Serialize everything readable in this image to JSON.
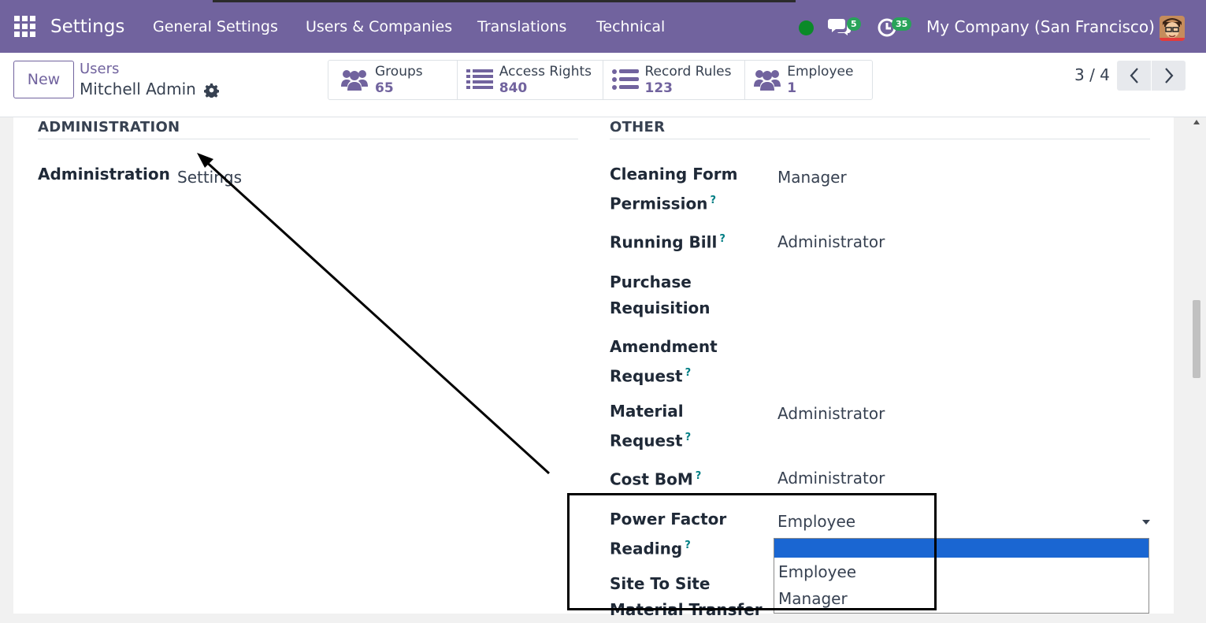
{
  "navbar": {
    "app_name": "Settings",
    "menu": {
      "general_settings": "General Settings",
      "users_companies": "Users & Companies",
      "translations": "Translations",
      "technical": "Technical"
    },
    "chat_count": "5",
    "activity_count": "35",
    "company": "My Company (San Francisco)",
    "status_color": "#0a8a28",
    "accent_color": "#71639e"
  },
  "control_panel": {
    "new_label": "New",
    "breadcrumb_parent": "Users",
    "record_title": "Mitchell Admin",
    "smart_buttons": [
      {
        "label": "Groups",
        "value": "65",
        "icon": "users-icon"
      },
      {
        "label": "Access Rights",
        "value": "840",
        "icon": "list-icon"
      },
      {
        "label": "Record Rules",
        "value": "123",
        "icon": "list-icon"
      },
      {
        "label": "Employee",
        "value": "1",
        "icon": "users-icon"
      }
    ],
    "pager": "3 / 4"
  },
  "form": {
    "administration": {
      "title": "ADMINISTRATION",
      "label": "Administration",
      "value": "Settings"
    },
    "other": {
      "title": "OTHER",
      "fields": [
        {
          "label_line1": "Cleaning Form",
          "label_line2": "Permission",
          "value": "Manager"
        },
        {
          "label_line1": "Running Bill",
          "label_line2": "",
          "value": "Administrator"
        },
        {
          "label_line1": "Purchase",
          "label_line2": "Requisition",
          "value": ""
        },
        {
          "label_line1": "Amendment",
          "label_line2": "Request",
          "value": ""
        },
        {
          "label_line1": "Material",
          "label_line2": "Request",
          "value": "Administrator"
        },
        {
          "label_line1": "Cost BoM",
          "label_line2": "",
          "value": "Administrator"
        },
        {
          "label_line1": "Power Factor",
          "label_line2": "Reading",
          "value": "Employee"
        },
        {
          "label_line1": "Site To Site",
          "label_line2": "Material Transfer",
          "value": ""
        }
      ],
      "help_mark": "?"
    },
    "dropdown_options": [
      "",
      "Employee",
      "Manager"
    ]
  }
}
